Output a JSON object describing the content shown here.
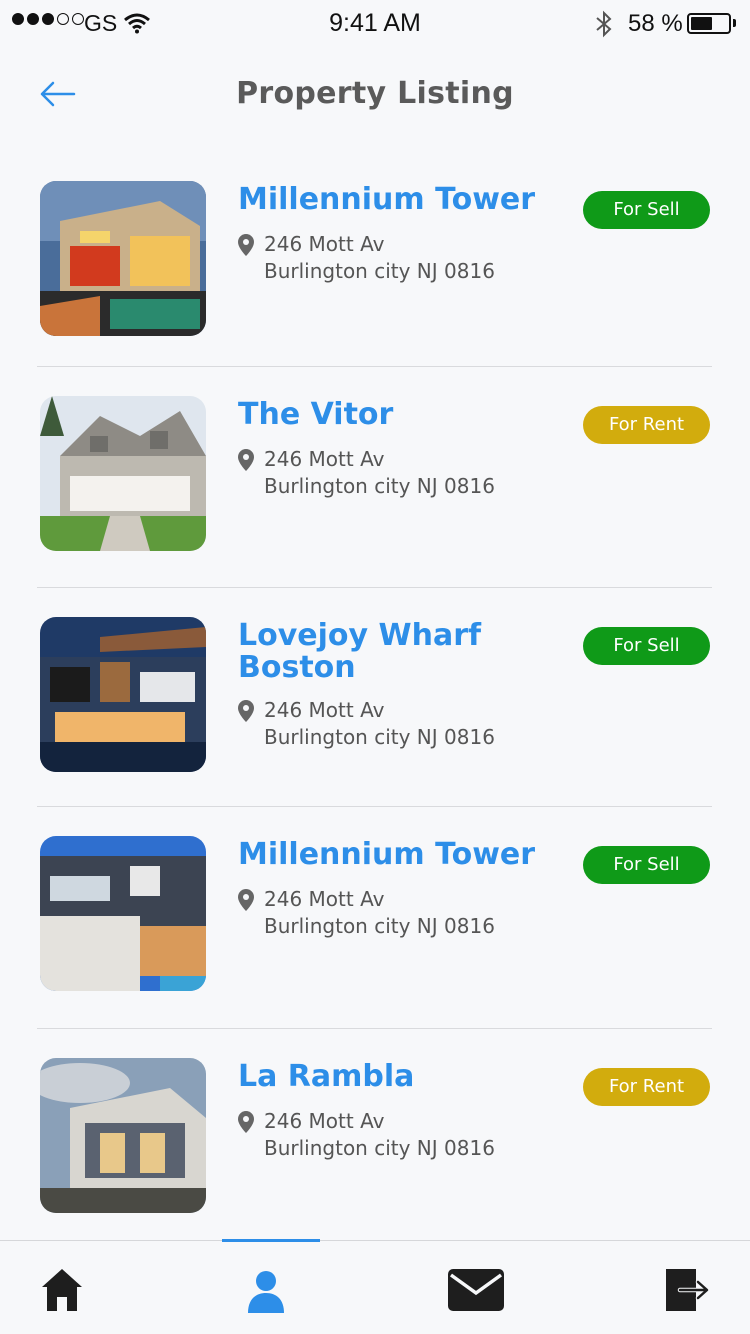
{
  "status_bar": {
    "carrier": "GS",
    "time": "9:41 AM",
    "battery": "58 %",
    "battery_level": 0.58
  },
  "header": {
    "title": "Property Listing"
  },
  "properties": [
    {
      "name": "Millennium Tower",
      "address_line1": "246 Mott Av",
      "address_line2": "Burlington city NJ 0816",
      "status": "For Sell",
      "status_color": "#0f9a18"
    },
    {
      "name": "The Vitor",
      "address_line1": "246 Mott Av",
      "address_line2": "Burlington city NJ 0816",
      "status": "For Rent",
      "status_color": "#d2ac0d"
    },
    {
      "name": "Lovejoy Wharf Boston",
      "address_line1": "246 Mott Av",
      "address_line2": "Burlington city NJ 0816",
      "status": "For Sell",
      "status_color": "#0f9a18"
    },
    {
      "name": "Millennium Tower",
      "address_line1": "246 Mott Av",
      "address_line2": "Burlington city NJ 0816",
      "status": "For Sell",
      "status_color": "#0f9a18"
    },
    {
      "name": "La Rambla",
      "address_line1": "246 Mott Av",
      "address_line2": "Burlington city NJ 0816",
      "status": "For Rent",
      "status_color": "#d2ac0d"
    }
  ],
  "tabs": [
    {
      "icon": "home-icon",
      "active": false
    },
    {
      "icon": "profile-icon",
      "active": true
    },
    {
      "icon": "mail-icon",
      "active": false
    },
    {
      "icon": "logout-icon",
      "active": false
    }
  ],
  "colors": {
    "accent": "#2d8ee8",
    "sell": "#0f9a18",
    "rent": "#d2ac0d"
  }
}
